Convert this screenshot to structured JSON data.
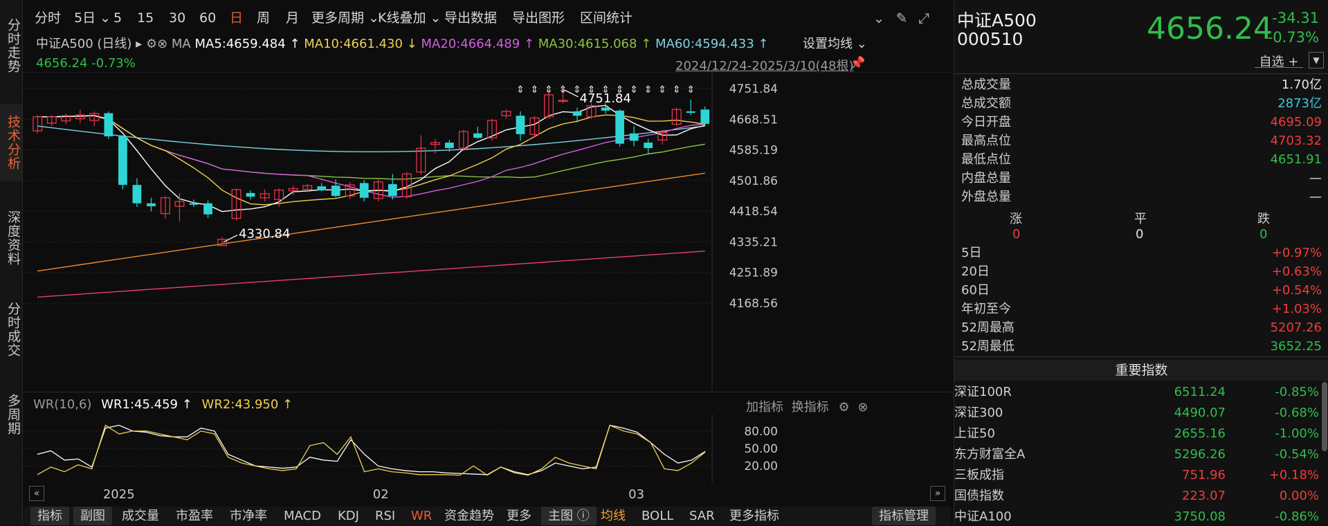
{
  "left_nav": [
    "分时走势",
    "技术分析",
    "深度资料",
    "分时成交",
    "多周期"
  ],
  "toolbar": {
    "items": [
      "分时",
      "5日",
      "5",
      "15",
      "30",
      "60",
      "日",
      "周",
      "月",
      "更多周期",
      "K线叠加",
      "导出数据",
      "导出图形",
      "区间统计"
    ],
    "active": "日"
  },
  "title_line": {
    "name": "中证A500 (日线)",
    "ma_label": "MA",
    "ma5": "MA5:4659.484 ↑",
    "ma10": "MA10:4661.430 ↓",
    "ma20": "MA20:4664.489 ↑",
    "ma30": "MA30:4615.068 ↑",
    "ma60": "MA60:4594.433 ↑",
    "setting": "设置均线",
    "price_change": "4656.24  -0.73%",
    "range": "2024/12/24-2025/3/10(48根)"
  },
  "colors": {
    "up": "#e8334a",
    "down": "#2fd4d4",
    "ma5": "#ffffff",
    "ma10": "#f0d050",
    "ma20": "#d060e0",
    "ma30": "#8cc63f",
    "ma60": "#7fd3e0",
    "long1": "#f08c30",
    "long2": "#e8406a"
  },
  "chart_data": {
    "type": "candlestick",
    "yticks": [
      "4751.84",
      "4668.51",
      "4585.19",
      "4501.86",
      "4418.54",
      "4335.21",
      "4251.89",
      "4168.56"
    ],
    "ylim": [
      4168.56,
      4751.84
    ],
    "xticks": [
      "2025",
      "02",
      "03"
    ],
    "annotations": [
      "4751.84",
      "4330.84"
    ],
    "candles": [
      {
        "o": 4637,
        "h": 4680,
        "l": 4630,
        "c": 4675
      },
      {
        "o": 4658,
        "h": 4680,
        "l": 4650,
        "c": 4675
      },
      {
        "o": 4664,
        "h": 4684,
        "l": 4655,
        "c": 4678
      },
      {
        "o": 4670,
        "h": 4694,
        "l": 4658,
        "c": 4680
      },
      {
        "o": 4665,
        "h": 4690,
        "l": 4650,
        "c": 4684
      },
      {
        "o": 4685,
        "h": 4690,
        "l": 4615,
        "c": 4622
      },
      {
        "o": 4622,
        "h": 4625,
        "l": 4478,
        "c": 4490
      },
      {
        "o": 4490,
        "h": 4508,
        "l": 4430,
        "c": 4440
      },
      {
        "o": 4440,
        "h": 4455,
        "l": 4418,
        "c": 4432
      },
      {
        "o": 4412,
        "h": 4460,
        "l": 4398,
        "c": 4455
      },
      {
        "o": 4432,
        "h": 4468,
        "l": 4390,
        "c": 4445
      },
      {
        "o": 4440,
        "h": 4450,
        "l": 4430,
        "c": 4436
      },
      {
        "o": 4440,
        "h": 4448,
        "l": 4400,
        "c": 4410
      },
      {
        "o": 4325,
        "h": 4348,
        "l": 4331,
        "c": 4342
      },
      {
        "o": 4399,
        "h": 4480,
        "l": 4393,
        "c": 4477
      },
      {
        "o": 4468,
        "h": 4475,
        "l": 4450,
        "c": 4458
      },
      {
        "o": 4455,
        "h": 4478,
        "l": 4445,
        "c": 4466
      },
      {
        "o": 4450,
        "h": 4480,
        "l": 4430,
        "c": 4476
      },
      {
        "o": 4474,
        "h": 4488,
        "l": 4462,
        "c": 4480
      },
      {
        "o": 4478,
        "h": 4492,
        "l": 4470,
        "c": 4488
      },
      {
        "o": 4486,
        "h": 4495,
        "l": 4473,
        "c": 4475
      },
      {
        "o": 4488,
        "h": 4505,
        "l": 4456,
        "c": 4460
      },
      {
        "o": 4460,
        "h": 4498,
        "l": 4452,
        "c": 4490
      },
      {
        "o": 4495,
        "h": 4503,
        "l": 4445,
        "c": 4455
      },
      {
        "o": 4453,
        "h": 4505,
        "l": 4445,
        "c": 4498
      },
      {
        "o": 4492,
        "h": 4520,
        "l": 4450,
        "c": 4460
      },
      {
        "o": 4458,
        "h": 4525,
        "l": 4452,
        "c": 4520
      },
      {
        "o": 4525,
        "h": 4625,
        "l": 4517,
        "c": 4590
      },
      {
        "o": 4600,
        "h": 4615,
        "l": 4575,
        "c": 4605
      },
      {
        "o": 4605,
        "h": 4612,
        "l": 4580,
        "c": 4590
      },
      {
        "o": 4590,
        "h": 4640,
        "l": 4582,
        "c": 4635
      },
      {
        "o": 4630,
        "h": 4648,
        "l": 4615,
        "c": 4618
      },
      {
        "o": 4618,
        "h": 4670,
        "l": 4610,
        "c": 4665
      },
      {
        "o": 4678,
        "h": 4695,
        "l": 4670,
        "c": 4690
      },
      {
        "o": 4678,
        "h": 4690,
        "l": 4610,
        "c": 4628
      },
      {
        "o": 4627,
        "h": 4677,
        "l": 4620,
        "c": 4672
      },
      {
        "o": 4675,
        "h": 4740,
        "l": 4670,
        "c": 4735
      },
      {
        "o": 4720,
        "h": 4752,
        "l": 4712,
        "c": 4720
      },
      {
        "o": 4690,
        "h": 4700,
        "l": 4660,
        "c": 4678
      },
      {
        "o": 4675,
        "h": 4712,
        "l": 4670,
        "c": 4705
      },
      {
        "o": 4700,
        "h": 4712,
        "l": 4684,
        "c": 4692
      },
      {
        "o": 4692,
        "h": 4696,
        "l": 4595,
        "c": 4602
      },
      {
        "o": 4630,
        "h": 4650,
        "l": 4595,
        "c": 4610
      },
      {
        "o": 4605,
        "h": 4615,
        "l": 4572,
        "c": 4590
      },
      {
        "o": 4612,
        "h": 4640,
        "l": 4600,
        "c": 4632
      },
      {
        "o": 4655,
        "h": 4700,
        "l": 4650,
        "c": 4695
      },
      {
        "o": 4690,
        "h": 4722,
        "l": 4680,
        "c": 4686
      },
      {
        "o": 4695,
        "h": 4703,
        "l": 4652,
        "c": 4656
      }
    ]
  },
  "indicator": {
    "name": "WR(10,6)",
    "wr1": "WR1:45.459 ↑",
    "wr2": "WR2:43.950 ↑",
    "add": "加指标",
    "switch": "换指标",
    "yticks": [
      "80.00",
      "50.00",
      "20.00"
    ],
    "wr1_values": [
      40,
      46,
      30,
      32,
      18,
      85,
      90,
      80,
      78,
      72,
      70,
      70,
      85,
      80,
      40,
      30,
      20,
      18,
      16,
      18,
      35,
      30,
      28,
      65,
      40,
      20,
      15,
      12,
      10,
      10,
      8,
      7,
      6,
      5,
      18,
      10,
      5,
      12,
      25,
      20,
      15,
      18,
      90,
      85,
      78,
      60,
      40,
      25,
      30,
      45
    ],
    "wr2_values": [
      5,
      18,
      10,
      22,
      15,
      90,
      75,
      80,
      80,
      75,
      70,
      65,
      80,
      75,
      35,
      25,
      20,
      15,
      12,
      15,
      55,
      60,
      40,
      70,
      10,
      15,
      10,
      8,
      5,
      5,
      5,
      4,
      20,
      4,
      18,
      8,
      4,
      15,
      35,
      25,
      20,
      15,
      90,
      80,
      75,
      60,
      15,
      12,
      25,
      44
    ]
  },
  "right_panel": {
    "name": "中证A500",
    "code": "000510",
    "price": "4656.24",
    "change": "-34.31",
    "change_pct": "-0.73%",
    "watch": "自选 +",
    "stats": [
      {
        "k": "总成交量",
        "v": "1.70亿",
        "c": "white"
      },
      {
        "k": "总成交额",
        "v": "2873亿",
        "c": "cyan"
      },
      {
        "k": "今日开盘",
        "v": "4695.09",
        "c": "red"
      },
      {
        "k": "最高点位",
        "v": "4703.32",
        "c": "red"
      },
      {
        "k": "最低点位",
        "v": "4651.91",
        "c": "green"
      },
      {
        "k": "内盘总量",
        "v": "—",
        "c": "white"
      },
      {
        "k": "外盘总量",
        "v": "—",
        "c": "white"
      }
    ],
    "breadth_labels": [
      "涨",
      "平",
      "跌"
    ],
    "breadth_values": [
      "0",
      "0",
      "0"
    ],
    "periods": [
      {
        "k": "5日",
        "v": "+0.97%",
        "c": "red"
      },
      {
        "k": "20日",
        "v": "+0.63%",
        "c": "red"
      },
      {
        "k": "60日",
        "v": "+0.54%",
        "c": "red"
      },
      {
        "k": "年初至今",
        "v": "+1.03%",
        "c": "red"
      },
      {
        "k": "52周最高",
        "v": "5207.26",
        "c": "red"
      },
      {
        "k": "52周最低",
        "v": "3652.25",
        "c": "green"
      }
    ],
    "index_title": "重要指数",
    "indices": [
      {
        "name": "深证100R",
        "value": "6511.24",
        "change": "-0.85%",
        "c": "green"
      },
      {
        "name": "深证300",
        "value": "4490.07",
        "change": "-0.68%",
        "c": "green"
      },
      {
        "name": "上证50",
        "value": "2655.16",
        "change": "-1.00%",
        "c": "green"
      },
      {
        "name": "东方财富全A",
        "value": "5296.26",
        "change": "-0.54%",
        "c": "green"
      },
      {
        "name": "三板成指",
        "value": "751.96",
        "change": "+0.18%",
        "c": "red"
      },
      {
        "name": "国债指数",
        "value": "223.07",
        "change": "0.00%",
        "c": "red"
      },
      {
        "name": "中证A100",
        "value": "3750.08",
        "change": "-0.86%",
        "c": "green"
      }
    ]
  },
  "bottom_bar": {
    "items": [
      "指标",
      "副图",
      "成交量",
      "市盈率",
      "市净率",
      "MACD",
      "KDJ",
      "RSI",
      "WR",
      "资金趋势",
      "更多",
      "主图",
      "均线",
      "BOLL",
      "SAR",
      "更多指标"
    ],
    "manage": "指标管理"
  }
}
